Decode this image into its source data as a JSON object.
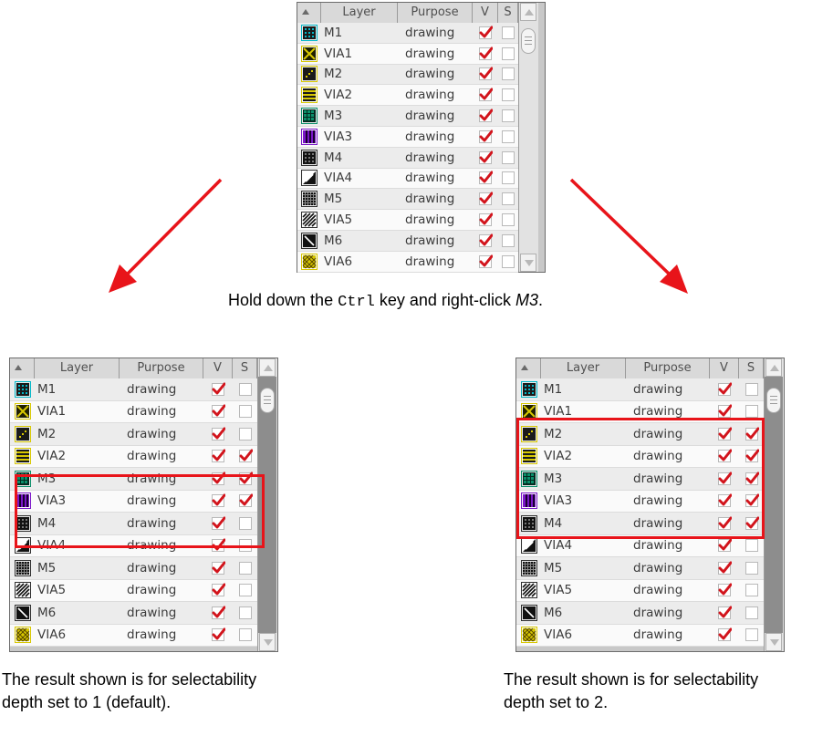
{
  "columns": {
    "layer": "Layer",
    "purpose": "Purpose",
    "v": "V",
    "s": "S"
  },
  "layers": [
    {
      "name": "M1",
      "purpose": "drawing",
      "icon": "metal1-icon",
      "color": "#00b7c8"
    },
    {
      "name": "VIA1",
      "purpose": "drawing",
      "icon": "via1-icon",
      "color": "#d8c800"
    },
    {
      "name": "M2",
      "purpose": "drawing",
      "icon": "metal2-icon",
      "color": "#d8c800"
    },
    {
      "name": "VIA2",
      "purpose": "drawing",
      "icon": "via2-icon",
      "color": "#d8c800"
    },
    {
      "name": "M3",
      "purpose": "drawing",
      "icon": "metal3-icon",
      "color": "#0a8f6a"
    },
    {
      "name": "VIA3",
      "purpose": "drawing",
      "icon": "via3-icon",
      "color": "#7a15c8"
    },
    {
      "name": "M4",
      "purpose": "drawing",
      "icon": "metal4-icon",
      "color": "#303030"
    },
    {
      "name": "VIA4",
      "purpose": "drawing",
      "icon": "via4-icon",
      "color": "#303030"
    },
    {
      "name": "M5",
      "purpose": "drawing",
      "icon": "metal5-icon",
      "color": "#303030"
    },
    {
      "name": "VIA5",
      "purpose": "drawing",
      "icon": "via5-icon",
      "color": "#303030"
    },
    {
      "name": "M6",
      "purpose": "drawing",
      "icon": "metal6-icon",
      "color": "#303030"
    },
    {
      "name": "VIA6",
      "purpose": "drawing",
      "icon": "via6-icon",
      "color": "#d8c800"
    }
  ],
  "panels": [
    {
      "id": "before",
      "v_checked": [
        true,
        true,
        true,
        true,
        true,
        true,
        true,
        true,
        true,
        true,
        true,
        true
      ],
      "s_checked": [
        false,
        false,
        false,
        false,
        false,
        false,
        false,
        false,
        false,
        false,
        false,
        false
      ]
    },
    {
      "id": "depth1",
      "v_checked": [
        true,
        true,
        true,
        true,
        true,
        true,
        true,
        true,
        true,
        true,
        true,
        true
      ],
      "s_checked": [
        false,
        false,
        false,
        true,
        true,
        true,
        false,
        false,
        false,
        false,
        false,
        false
      ]
    },
    {
      "id": "depth2",
      "v_checked": [
        true,
        true,
        true,
        true,
        true,
        true,
        true,
        true,
        true,
        true,
        true,
        true
      ],
      "s_checked": [
        false,
        false,
        true,
        true,
        true,
        true,
        true,
        false,
        false,
        false,
        false,
        false
      ]
    }
  ],
  "instruction": {
    "prefix": "Hold down the ",
    "key": "Ctrl",
    "middle": " key and right-click ",
    "target": "M3",
    "suffix": "."
  },
  "caption_depth1": {
    "line1": "The result shown is for selectability",
    "line2": "depth set to 1 (default)."
  },
  "caption_depth2": {
    "line1": "The result shown is for selectability",
    "line2": "depth set to 2."
  },
  "colors": {
    "highlight": "#e8141a",
    "arrow": "#e8141a",
    "check": "#d2141c"
  }
}
